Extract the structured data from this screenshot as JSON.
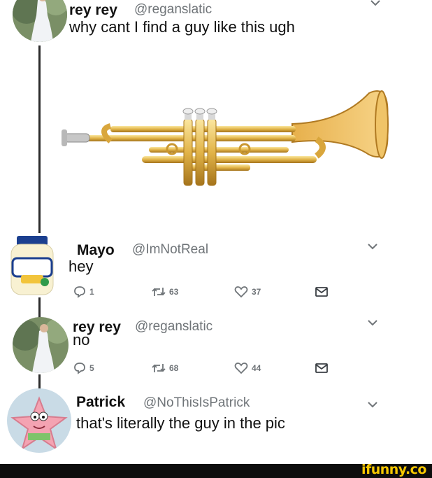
{
  "colors": {
    "handle": "#6f7478",
    "brand": "#f6c700",
    "thread_line": "#2b2b2b"
  },
  "tweets": [
    {
      "name": "rey rey",
      "handle": "@reganslatic",
      "text": "why cant I find a guy like this ugh",
      "avatar": "woman-in-white-dress",
      "media": "trumpet"
    },
    {
      "name": "Mayo",
      "handle": "@ImNotReal",
      "text": "hey",
      "avatar": "mayonnaise-jar",
      "avatar_label": "HELLMANN'S",
      "replies": "1",
      "retweets": "63",
      "likes": "37"
    },
    {
      "name": "rey rey",
      "handle": "@reganslatic",
      "text": "no",
      "avatar": "woman-in-white-dress",
      "replies": "5",
      "retweets": "68",
      "likes": "44"
    },
    {
      "name": "Patrick",
      "handle": "@NoThisIsPatrick",
      "text": "that's literally the guy in the pic",
      "avatar": "patrick-star"
    }
  ],
  "footer": {
    "brand": "ifunny.co"
  }
}
